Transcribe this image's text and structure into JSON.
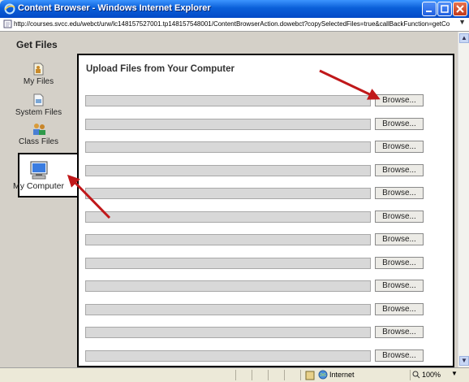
{
  "window": {
    "title": "Content Browser - Windows Internet Explorer",
    "address": "http://courses.svcc.edu/webct/urw/lc148157527001.tp148157548001/ContentBrowserAction.dowebct?copySelectedFiles=true&callBackFunction=getCo"
  },
  "sidebar": {
    "title": "Get Files",
    "items": [
      {
        "label": "My Files",
        "icon": "my-files-icon"
      },
      {
        "label": "System Files",
        "icon": "system-files-icon"
      },
      {
        "label": "Class Files",
        "icon": "class-files-icon"
      },
      {
        "label": "My Computer",
        "icon": "computer-icon",
        "selected": true
      }
    ]
  },
  "upload": {
    "title": "Upload Files from Your Computer",
    "browse_label": "Browse...",
    "rows": 12
  },
  "statusbar": {
    "zone": "Internet",
    "zoom": "100%"
  },
  "annotations": {
    "arrow_color": "#c0181a"
  }
}
